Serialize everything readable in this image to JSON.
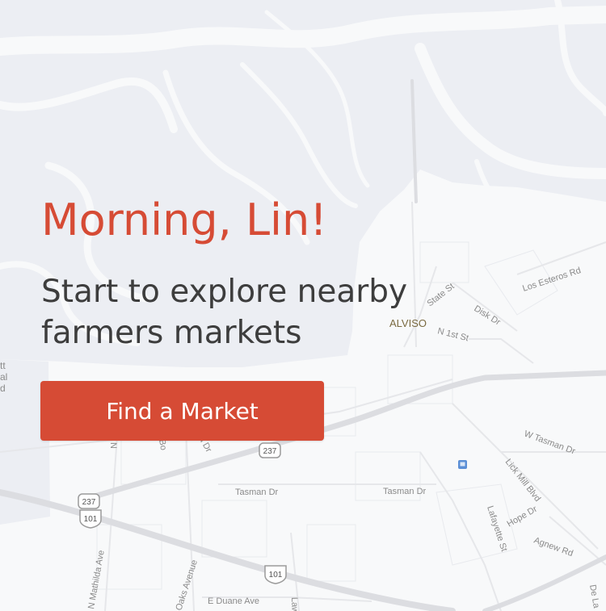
{
  "hero": {
    "greeting": "Morning, Lin!",
    "subtitle": "Start to explore nearby farmers markets",
    "cta_label": "Find a Market"
  },
  "map": {
    "place_labels": {
      "alviso": "ALVISO",
      "state_st": "State St",
      "disk_dr": "Disk Dr",
      "n_1st_st": "N 1st St",
      "los_esteros_rd": "Los Esteros Rd",
      "w_tasman_dr": "W Tasman Dr",
      "lick_mill_blvd": "Lick Mill Blvd",
      "hope_dr": "Hope Dr",
      "lafayette_st": "Lafayette St",
      "agnew_rd": "Agnew Rd",
      "tasman_dr_1": "Tasman Dr",
      "tasman_dr_2": "Tasman Dr",
      "n_mathilda_ave": "N Mathilda Ave",
      "oaks_avenue": "Oaks Avenue",
      "e_duane_ave": "E Duane Ave",
      "law": "Law",
      "de_la": "De La",
      "n_short": "N",
      "bo_short": "Bo",
      "a_dr_short": "a Dr",
      "left_edge": "tt\nal\nd"
    },
    "shields": {
      "hwy_237_a": "237",
      "hwy_237_b": "237",
      "hwy_101_a": "101",
      "hwy_101_b": "101"
    }
  },
  "colors": {
    "accent": "#d64b35",
    "text_dark": "#3d3d3d",
    "map_land": "#ffffff",
    "map_water": "#eceef3"
  }
}
